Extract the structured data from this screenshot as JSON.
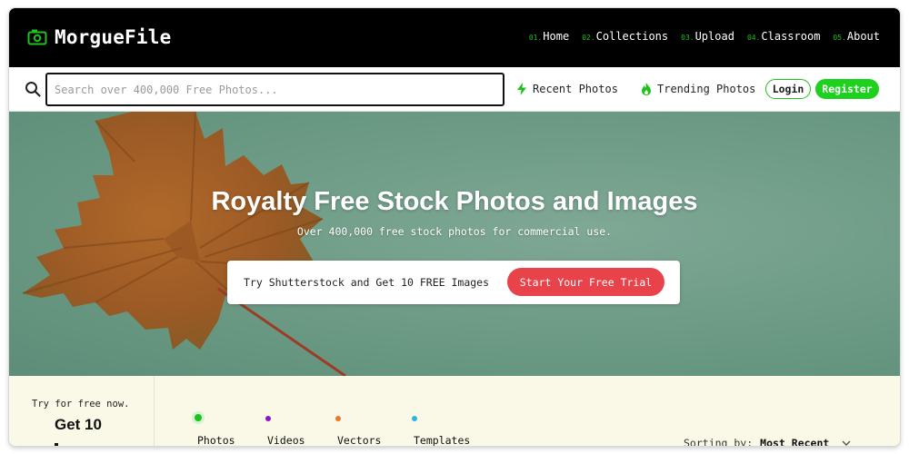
{
  "header": {
    "logo_text": "MorgueFile",
    "nav": [
      {
        "num": "01.",
        "label": "Home"
      },
      {
        "num": "02.",
        "label": "Collections"
      },
      {
        "num": "03.",
        "label": "Upload"
      },
      {
        "num": "04.",
        "label": "Classroom"
      },
      {
        "num": "05.",
        "label": "About"
      }
    ]
  },
  "search": {
    "placeholder": "Search over 400,000 Free Photos...",
    "value": ""
  },
  "quicklinks": {
    "recent": "Recent Photos",
    "trending": "Trending Photos"
  },
  "auth": {
    "login": "Login",
    "register": "Register"
  },
  "hero": {
    "title": "Royalty Free Stock Photos and Images",
    "subtitle": "Over 400,000 free stock photos for commercial use.",
    "promo_text": "Try Shutterstock and Get 10 FREE Images",
    "promo_button": "Start Your Free Trial"
  },
  "sidebar_promo": {
    "try_text": "Try for free now.",
    "headline": "Get 10"
  },
  "media_tabs": [
    {
      "label": "Photos",
      "color": "#1fc11f"
    },
    {
      "label": "Videos",
      "color": "#8a14c8"
    },
    {
      "label": "Vectors",
      "color": "#e8782a"
    },
    {
      "label": "Templates",
      "color": "#2ab4e0"
    }
  ],
  "sorting": {
    "label": "Sorting by:",
    "value": "Most Recent"
  },
  "colors": {
    "accent_green": "#1fc11f",
    "promo_red": "#e8424a",
    "hero_bg": "#6e9c87"
  }
}
